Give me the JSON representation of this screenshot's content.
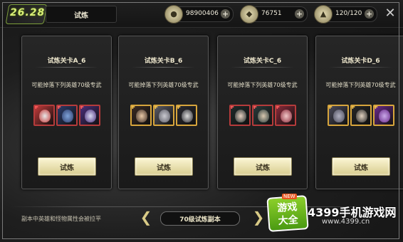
{
  "header": {
    "level_badge": "26.28",
    "stage_title": "试炼",
    "resources": [
      {
        "name": "coin",
        "value": "98900406",
        "icon": "coin-icon"
      },
      {
        "name": "gem",
        "value": "76751",
        "icon": "gem-icon"
      },
      {
        "name": "stamina",
        "value": "120/120",
        "icon": "stamina-icon"
      }
    ],
    "close_icon": "close-icon"
  },
  "cards": [
    {
      "title": "试炼关卡A_6",
      "desc": "可能掉落下列英雄70级专武",
      "button": "试炼",
      "heroes": [
        {
          "frame": "red",
          "colors": [
            "#c23a3a",
            "#e8e8e8"
          ]
        },
        {
          "frame": "red",
          "colors": [
            "#2c3b6a",
            "#7fa2d8"
          ]
        },
        {
          "frame": "red",
          "colors": [
            "#4a2e7a",
            "#d9d9f2"
          ]
        }
      ]
    },
    {
      "title": "试炼关卡B_6",
      "desc": "可能掉落下列英雄70级专武",
      "button": "试炼",
      "heroes": [
        {
          "frame": "gold",
          "colors": [
            "#3a2a22",
            "#e9c9a8"
          ]
        },
        {
          "frame": "gold",
          "colors": [
            "#5c5c66",
            "#c9c9d0"
          ]
        },
        {
          "frame": "gold",
          "colors": [
            "#2a2a30",
            "#dcdcdc"
          ]
        }
      ]
    },
    {
      "title": "试炼关卡C_6",
      "desc": "可能掉落下列英雄70级专武",
      "button": "试炼",
      "heroes": [
        {
          "frame": "red",
          "colors": [
            "#1e2a2a",
            "#e6d0c0"
          ]
        },
        {
          "frame": "red",
          "colors": [
            "#2a3a3a",
            "#d8c8b0"
          ]
        },
        {
          "frame": "red",
          "colors": [
            "#8a2a3a",
            "#f0c8c8"
          ]
        }
      ]
    },
    {
      "title": "试炼关卡D_6",
      "desc": "可能掉落下列英雄70级专武",
      "button": "试炼",
      "heroes": [
        {
          "frame": "gold",
          "colors": [
            "#4a4a5a",
            "#b0b0c0"
          ]
        },
        {
          "frame": "gold",
          "colors": [
            "#262626",
            "#e0d0c0"
          ]
        },
        {
          "frame": "gold",
          "colors": [
            "#6a2a8a",
            "#c8a8e8"
          ]
        }
      ]
    }
  ],
  "footer": {
    "hint": "副本中英雄和怪物属性会被拉平",
    "dungeon_label": "70级试炼副本",
    "left_arrow_icon": "chevron-left-icon",
    "right_arrow_icon": "chevron-right-icon"
  },
  "watermark": {
    "logo_line1": "游戏",
    "logo_line2": "大全",
    "badge": "NEW",
    "site": "4399手机游戏网",
    "url": "www.4399.cn"
  }
}
